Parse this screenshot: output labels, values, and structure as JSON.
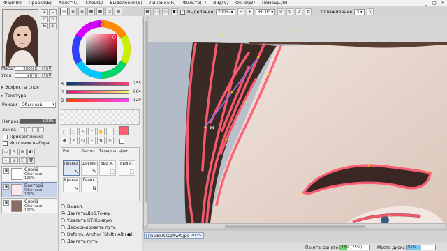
{
  "menubar": {
    "items": [
      "Файл(F)",
      "Правка(E)",
      "Холст(C)",
      "Слой(L)",
      "Выделения(S)",
      "Линейка(R)",
      "Фильтр(T)",
      "Вид(V)",
      "Окно(W)",
      "Помощь(H)"
    ],
    "minimize": "_",
    "maximize": "□",
    "close": "✕"
  },
  "canvas_toolbar": {
    "selection_label": "Выделение",
    "zoom": "200%",
    "rotation": "+0.0°",
    "smoothing_label": "Сглаживание",
    "smoothing_value": "3"
  },
  "navigator": {
    "scale_label": "Масштаб",
    "scale_value": "200%",
    "angle_label": "Угол",
    "angle_value": "+0°"
  },
  "layer_props": {
    "effects_label": "Эффекты слоя",
    "texture_label": "Текстура",
    "mode_label": "Режим",
    "mode_value": "Обычный",
    "opacity_label": "Непроз.",
    "opacity_value": "100%",
    "lock_label": "Замок",
    "clip_label": "Прикрепление",
    "selection_source_label": "Источник выбора"
  },
  "color": {
    "r_label": "R",
    "r_value": "255",
    "r_fraction": 1.0,
    "g_label": "G",
    "g_value": "064",
    "g_fraction": 0.25,
    "b_label": "B",
    "b_value": "120",
    "b_fraction": 0.47,
    "main": "#ff4078",
    "accent": "#ff5d72"
  },
  "layers": [
    {
      "name": "Слой2",
      "mode": "Обычный",
      "opacity": "100%",
      "selected": false
    },
    {
      "name": "Вектор1",
      "mode": "Обычный",
      "opacity": "100%",
      "selected": true
    },
    {
      "name": "Слой1",
      "mode": "Обычный",
      "opacity": "100%",
      "selected": false
    }
  ],
  "brush_panel": {
    "headers": [
      "Рсп",
      "Ластик",
      "Толщина",
      "Цвет"
    ],
    "cells": [
      "Правка",
      "Давлен.",
      "Выд.К.",
      "Выд.Р.",
      "Кривая",
      "Линия"
    ]
  },
  "tool_options": [
    {
      "label": "Выдел.",
      "checked": false
    },
    {
      "label": "Двигать/Доб.Точку",
      "checked": true
    },
    {
      "label": "Удалить КТ/Кривую",
      "checked": false
    },
    {
      "label": "Деформировать путь",
      "checked": false
    },
    {
      "label": "Deform. Anchor (Shift+Alt+●)",
      "checked": false
    },
    {
      "label": "Двигать путь",
      "checked": false
    }
  ],
  "document": {
    "filename": "GGE5RXs2XwA.jpg",
    "zoom": "200%"
  },
  "status": {
    "memory_label": "Памяти занято",
    "memory_percent": "23%",
    "memory_paren": "(25%)",
    "memory_fraction": 0.23,
    "disk_label": "Место диска",
    "disk_percent": "51%",
    "disk_fraction": 0.51
  }
}
